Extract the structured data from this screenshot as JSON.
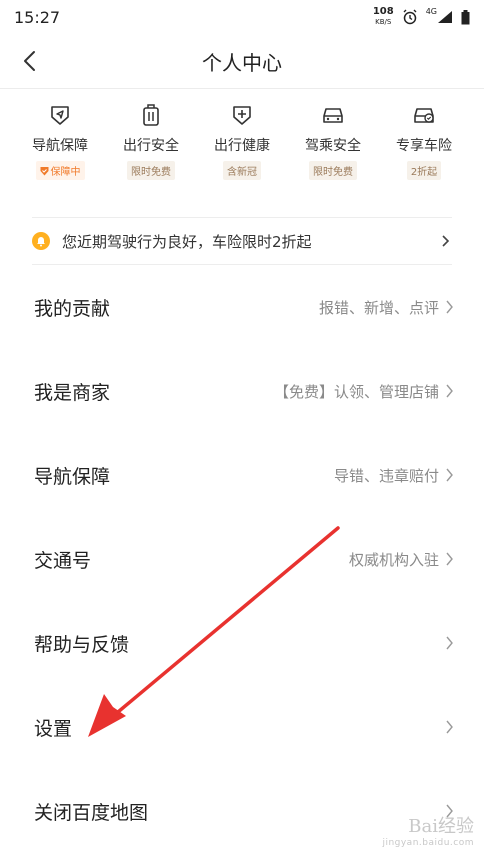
{
  "status_bar": {
    "time": "15:27",
    "net_speed": "108",
    "net_unit": "KB/S",
    "network": "4G"
  },
  "header": {
    "title": "个人中心",
    "back_icon": "chevron-left-icon"
  },
  "services": [
    {
      "name": "导航保障",
      "badge": "保障中",
      "icon": "shield-navigation-icon",
      "active": true
    },
    {
      "name": "出行安全",
      "badge": "限时免费",
      "icon": "luggage-icon",
      "active": false
    },
    {
      "name": "出行健康",
      "badge": "含新冠",
      "icon": "shield-plus-icon",
      "active": false
    },
    {
      "name": "驾乘安全",
      "badge": "限时免费",
      "icon": "car-icon",
      "active": false
    },
    {
      "name": "专享车险",
      "badge": "2折起",
      "icon": "car-shield-icon",
      "active": false
    }
  ],
  "notice": {
    "text": "您近期驾驶行为良好，车险限时2折起",
    "icon": "bell-icon"
  },
  "menu": [
    {
      "label": "我的贡献",
      "hint": "报错、新增、点评"
    },
    {
      "label": "我是商家",
      "hint": "【免费】认领、管理店铺"
    },
    {
      "label": "导航保障",
      "hint": "导错、违章赔付"
    },
    {
      "label": "交通号",
      "hint": "权威机构入驻"
    },
    {
      "label": "帮助与反馈",
      "hint": ""
    },
    {
      "label": "设置",
      "hint": ""
    },
    {
      "label": "关闭百度地图",
      "hint": ""
    }
  ],
  "annotation": {
    "color": "#e8322f"
  },
  "watermark": {
    "brand": "Bai经验",
    "site": "jingyan.baidu.com"
  },
  "colors": {
    "accent": "#f07a2a",
    "badge_text": "#9a7a5a"
  }
}
